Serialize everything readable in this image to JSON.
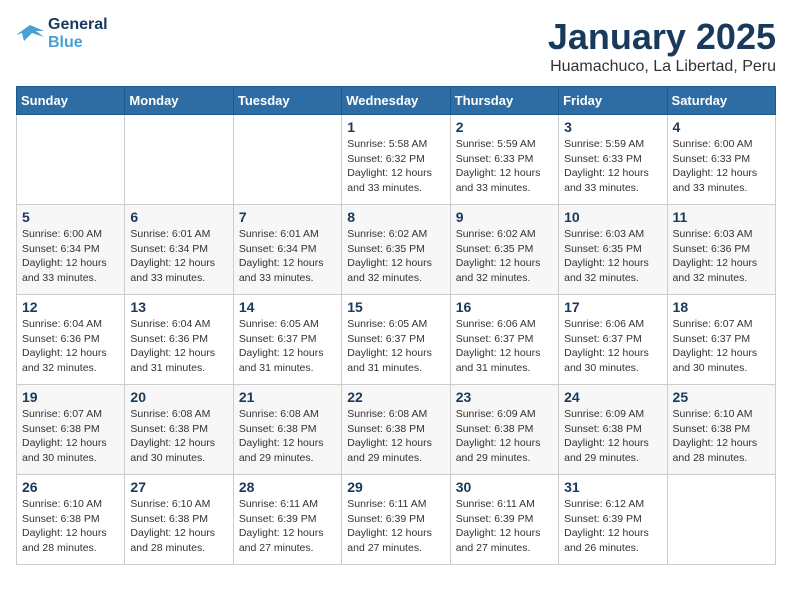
{
  "header": {
    "logo_line1": "General",
    "logo_line2": "Blue",
    "title": "January 2025",
    "subtitle": "Huamachuco, La Libertad, Peru"
  },
  "weekdays": [
    "Sunday",
    "Monday",
    "Tuesday",
    "Wednesday",
    "Thursday",
    "Friday",
    "Saturday"
  ],
  "weeks": [
    [
      {
        "day": "",
        "info": ""
      },
      {
        "day": "",
        "info": ""
      },
      {
        "day": "",
        "info": ""
      },
      {
        "day": "1",
        "info": "Sunrise: 5:58 AM\nSunset: 6:32 PM\nDaylight: 12 hours\nand 33 minutes."
      },
      {
        "day": "2",
        "info": "Sunrise: 5:59 AM\nSunset: 6:33 PM\nDaylight: 12 hours\nand 33 minutes."
      },
      {
        "day": "3",
        "info": "Sunrise: 5:59 AM\nSunset: 6:33 PM\nDaylight: 12 hours\nand 33 minutes."
      },
      {
        "day": "4",
        "info": "Sunrise: 6:00 AM\nSunset: 6:33 PM\nDaylight: 12 hours\nand 33 minutes."
      }
    ],
    [
      {
        "day": "5",
        "info": "Sunrise: 6:00 AM\nSunset: 6:34 PM\nDaylight: 12 hours\nand 33 minutes."
      },
      {
        "day": "6",
        "info": "Sunrise: 6:01 AM\nSunset: 6:34 PM\nDaylight: 12 hours\nand 33 minutes."
      },
      {
        "day": "7",
        "info": "Sunrise: 6:01 AM\nSunset: 6:34 PM\nDaylight: 12 hours\nand 33 minutes."
      },
      {
        "day": "8",
        "info": "Sunrise: 6:02 AM\nSunset: 6:35 PM\nDaylight: 12 hours\nand 32 minutes."
      },
      {
        "day": "9",
        "info": "Sunrise: 6:02 AM\nSunset: 6:35 PM\nDaylight: 12 hours\nand 32 minutes."
      },
      {
        "day": "10",
        "info": "Sunrise: 6:03 AM\nSunset: 6:35 PM\nDaylight: 12 hours\nand 32 minutes."
      },
      {
        "day": "11",
        "info": "Sunrise: 6:03 AM\nSunset: 6:36 PM\nDaylight: 12 hours\nand 32 minutes."
      }
    ],
    [
      {
        "day": "12",
        "info": "Sunrise: 6:04 AM\nSunset: 6:36 PM\nDaylight: 12 hours\nand 32 minutes."
      },
      {
        "day": "13",
        "info": "Sunrise: 6:04 AM\nSunset: 6:36 PM\nDaylight: 12 hours\nand 31 minutes."
      },
      {
        "day": "14",
        "info": "Sunrise: 6:05 AM\nSunset: 6:37 PM\nDaylight: 12 hours\nand 31 minutes."
      },
      {
        "day": "15",
        "info": "Sunrise: 6:05 AM\nSunset: 6:37 PM\nDaylight: 12 hours\nand 31 minutes."
      },
      {
        "day": "16",
        "info": "Sunrise: 6:06 AM\nSunset: 6:37 PM\nDaylight: 12 hours\nand 31 minutes."
      },
      {
        "day": "17",
        "info": "Sunrise: 6:06 AM\nSunset: 6:37 PM\nDaylight: 12 hours\nand 30 minutes."
      },
      {
        "day": "18",
        "info": "Sunrise: 6:07 AM\nSunset: 6:37 PM\nDaylight: 12 hours\nand 30 minutes."
      }
    ],
    [
      {
        "day": "19",
        "info": "Sunrise: 6:07 AM\nSunset: 6:38 PM\nDaylight: 12 hours\nand 30 minutes."
      },
      {
        "day": "20",
        "info": "Sunrise: 6:08 AM\nSunset: 6:38 PM\nDaylight: 12 hours\nand 30 minutes."
      },
      {
        "day": "21",
        "info": "Sunrise: 6:08 AM\nSunset: 6:38 PM\nDaylight: 12 hours\nand 29 minutes."
      },
      {
        "day": "22",
        "info": "Sunrise: 6:08 AM\nSunset: 6:38 PM\nDaylight: 12 hours\nand 29 minutes."
      },
      {
        "day": "23",
        "info": "Sunrise: 6:09 AM\nSunset: 6:38 PM\nDaylight: 12 hours\nand 29 minutes."
      },
      {
        "day": "24",
        "info": "Sunrise: 6:09 AM\nSunset: 6:38 PM\nDaylight: 12 hours\nand 29 minutes."
      },
      {
        "day": "25",
        "info": "Sunrise: 6:10 AM\nSunset: 6:38 PM\nDaylight: 12 hours\nand 28 minutes."
      }
    ],
    [
      {
        "day": "26",
        "info": "Sunrise: 6:10 AM\nSunset: 6:38 PM\nDaylight: 12 hours\nand 28 minutes."
      },
      {
        "day": "27",
        "info": "Sunrise: 6:10 AM\nSunset: 6:38 PM\nDaylight: 12 hours\nand 28 minutes."
      },
      {
        "day": "28",
        "info": "Sunrise: 6:11 AM\nSunset: 6:39 PM\nDaylight: 12 hours\nand 27 minutes."
      },
      {
        "day": "29",
        "info": "Sunrise: 6:11 AM\nSunset: 6:39 PM\nDaylight: 12 hours\nand 27 minutes."
      },
      {
        "day": "30",
        "info": "Sunrise: 6:11 AM\nSunset: 6:39 PM\nDaylight: 12 hours\nand 27 minutes."
      },
      {
        "day": "31",
        "info": "Sunrise: 6:12 AM\nSunset: 6:39 PM\nDaylight: 12 hours\nand 26 minutes."
      },
      {
        "day": "",
        "info": ""
      }
    ]
  ]
}
